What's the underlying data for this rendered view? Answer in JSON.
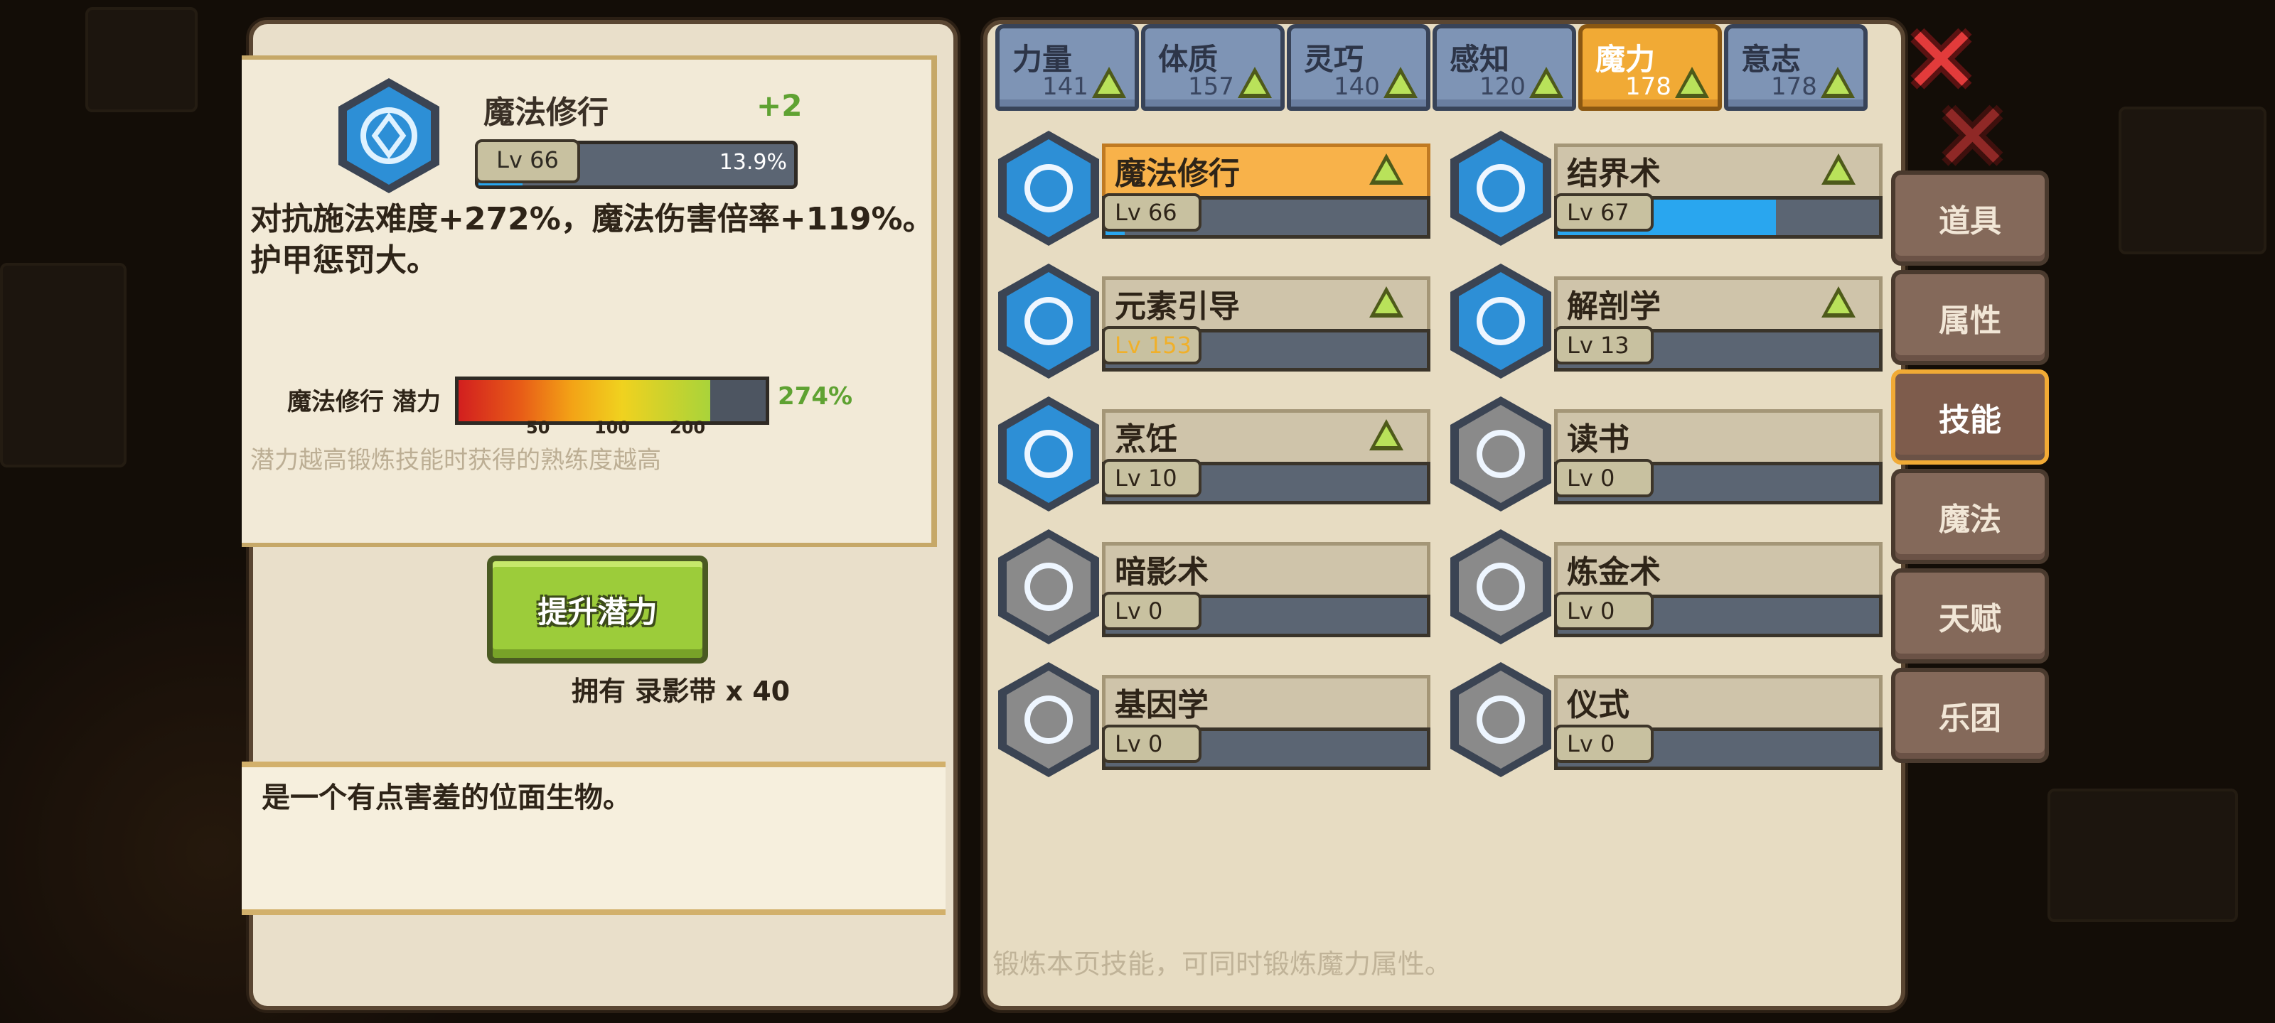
{
  "detail": {
    "skill_name": "魔法修行",
    "bonus": "+2",
    "level": "Lv 66",
    "progress_text": "13.9%",
    "progress": 0.139,
    "description_line1": "对抗施法难度+272%，魔法伤害倍率+119%。",
    "description_line2": "护甲惩罚大。",
    "potential_label": "魔法修行 潜力",
    "potential_value": "274%",
    "potential_fill": 0.82,
    "ticks": [
      "50",
      "100",
      "200"
    ],
    "hint": "潜力越高锻炼技能时获得的熟练度越高",
    "upgrade_button": "提升潜力",
    "owned": "拥有 录影带 x 40",
    "flavor": "是一个有点害羞的位面生物。"
  },
  "attribute_tabs": [
    {
      "name": "力量",
      "value": "141"
    },
    {
      "name": "体质",
      "value": "157"
    },
    {
      "name": "灵巧",
      "value": "140"
    },
    {
      "name": "感知",
      "value": "120"
    },
    {
      "name": "魔力",
      "value": "178"
    },
    {
      "name": "意志",
      "value": "178"
    }
  ],
  "skills": [
    {
      "name": "魔法修行",
      "level": "Lv 66",
      "fill": 0.06,
      "up": true
    },
    {
      "name": "结界术",
      "level": "Lv 67",
      "fill": 0.68,
      "up": true
    },
    {
      "name": "元素引导",
      "level": "Lv 153",
      "fill": 0.0,
      "up": true
    },
    {
      "name": "解剖学",
      "level": "Lv 13",
      "fill": 0.0,
      "up": true
    },
    {
      "name": "烹饪",
      "level": "Lv 10",
      "fill": 0.0,
      "up": true
    },
    {
      "name": "读书",
      "level": "Lv 0",
      "fill": 0.0,
      "up": false
    },
    {
      "name": "暗影术",
      "level": "Lv 0",
      "fill": 0.0,
      "up": false
    },
    {
      "name": "炼金术",
      "level": "Lv 0",
      "fill": 0.0,
      "up": false
    },
    {
      "name": "基因学",
      "level": "Lv 0",
      "fill": 0.0,
      "up": false
    },
    {
      "name": "仪式",
      "level": "Lv 0",
      "fill": 0.0,
      "up": false
    }
  ],
  "footer_hint": "锻炼本页技能，可同时锻炼魔力属性。",
  "side_menu": [
    "道具",
    "属性",
    "技能",
    "魔法",
    "天赋",
    "乐团"
  ],
  "colors": {
    "accent": "#f1aa35",
    "progress": "#29a6ef",
    "green": "#9ccc3a",
    "close": "#e23b3b"
  }
}
